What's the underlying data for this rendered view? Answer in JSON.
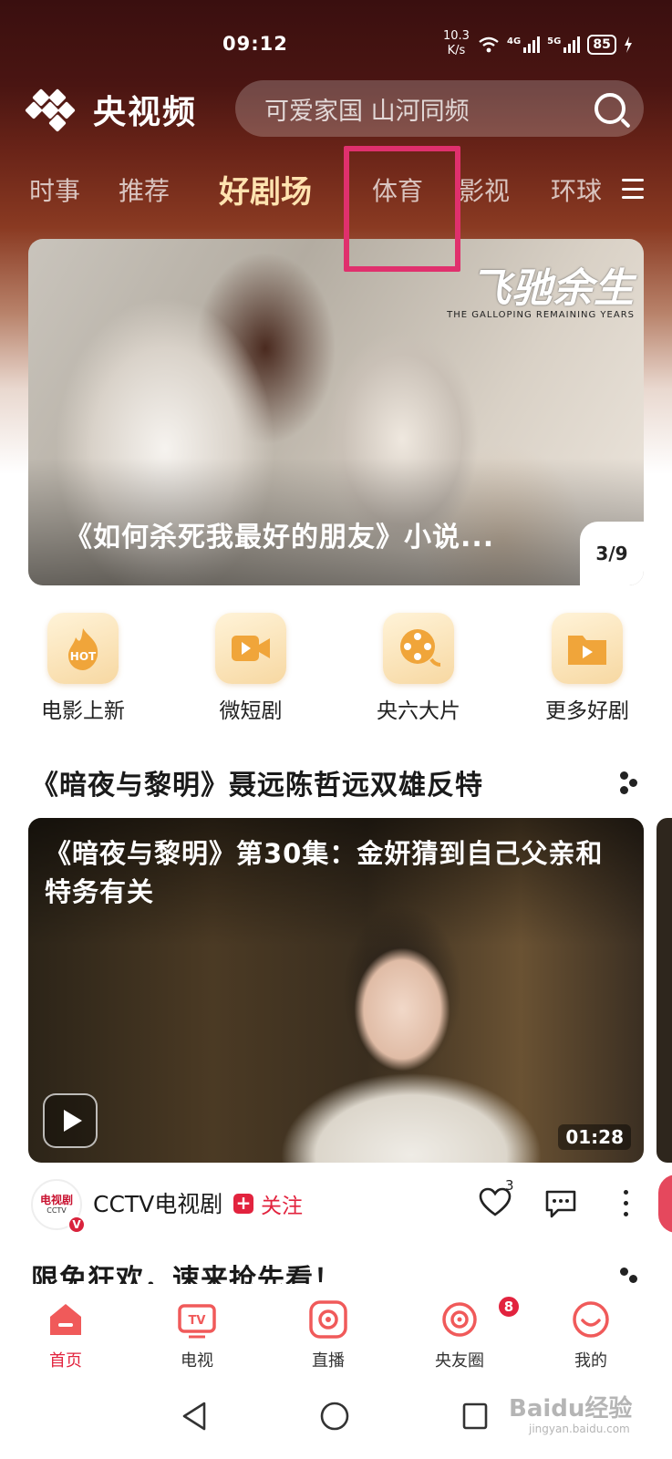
{
  "status_bar": {
    "time": "09:12",
    "net_speed_value": "10.3",
    "net_speed_unit": "K/s",
    "sim1_label": "4G",
    "sim2_label": "5G",
    "battery": "85"
  },
  "header": {
    "app_name": "央视频",
    "search_placeholder": "可爱家国 山河同频"
  },
  "tabs": [
    {
      "label": "时事"
    },
    {
      "label": "推荐"
    },
    {
      "label": "好剧场",
      "active": true
    },
    {
      "label": "体育"
    },
    {
      "label": "影视"
    },
    {
      "label": "环球"
    }
  ],
  "banner": {
    "logo_title": "飞驰余生",
    "logo_subtitle": "THE GALLOPING REMAINING YEARS",
    "caption": "《如何杀死我最好的朋友》小说...",
    "counter": "3/9"
  },
  "quick_links": [
    {
      "label": "电影上新",
      "icon": "hot-icon"
    },
    {
      "label": "微短剧",
      "icon": "video-camera-icon"
    },
    {
      "label": "央六大片",
      "icon": "film-reel-icon"
    },
    {
      "label": "更多好剧",
      "icon": "folder-play-icon"
    }
  ],
  "section1": {
    "title": "《暗夜与黎明》聂远陈哲远双雄反特"
  },
  "video_card": {
    "caption": "《暗夜与黎明》第30集：金妍猜到自己父亲和特务有关",
    "duration": "01:28"
  },
  "channel": {
    "avatar_text": "电视剧",
    "avatar_sub": "CCTV",
    "verified": "V",
    "name": "CCTV电视剧",
    "follow_label": "关注",
    "like_count": "3"
  },
  "section2": {
    "title": "限免狂欢，速来抢先看！"
  },
  "bottom_nav": [
    {
      "label": "首页",
      "active": true
    },
    {
      "label": "电视"
    },
    {
      "label": "直播"
    },
    {
      "label": "央友圈",
      "badge": "8"
    },
    {
      "label": "我的"
    }
  ],
  "watermark": {
    "text": "Baidu经验",
    "sub": "jingyan.baidu.com"
  },
  "colors": {
    "accent": "#e2233e",
    "highlight_box": "#e0306d",
    "active_tab": "#ffe3b0"
  }
}
